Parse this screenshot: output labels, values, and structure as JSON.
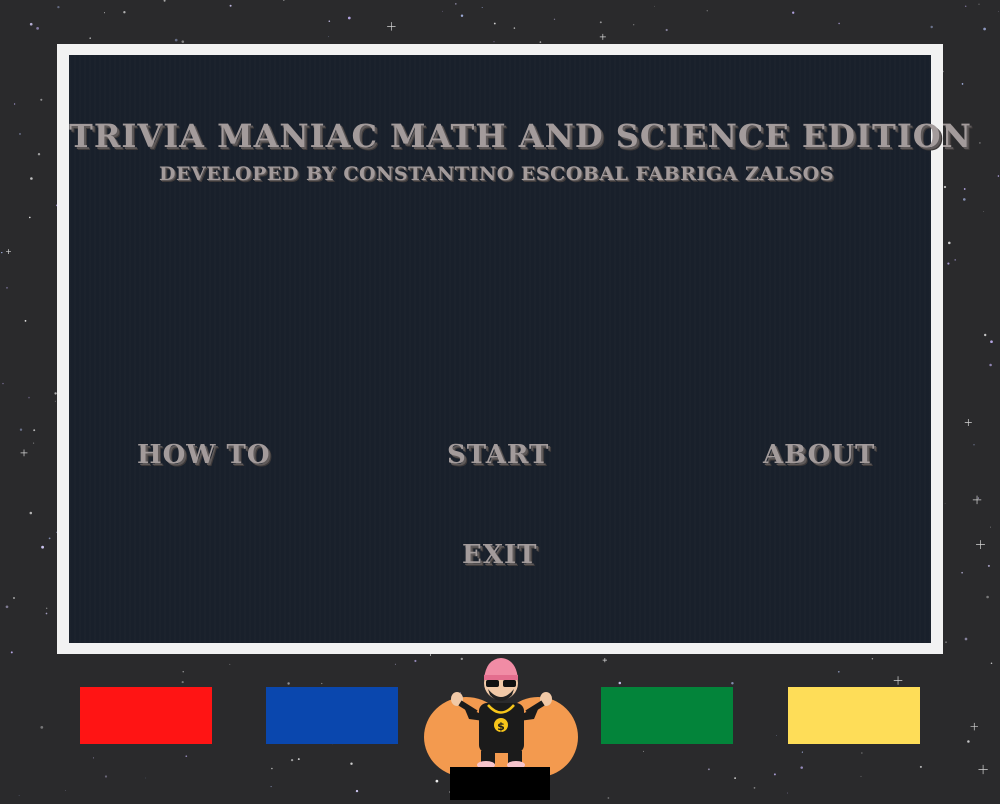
{
  "title": "TRIVIA MANIAC  MATH AND SCIENCE EDITION",
  "subtitle": "DEVELOPED BY CONSTANTINO  ESCOBAL  FABRIGA ZALSOS",
  "menu": {
    "how_to": "HOW  TO",
    "start": "START",
    "about": "ABOUT",
    "exit": "EXIT"
  },
  "answer_swatches": [
    {
      "color": "#ff1414"
    },
    {
      "color": "#0a47ae"
    },
    {
      "color": "#03843a"
    },
    {
      "color": "#fedd58"
    }
  ],
  "mascot": {
    "icon": "host-mascot-icon"
  }
}
